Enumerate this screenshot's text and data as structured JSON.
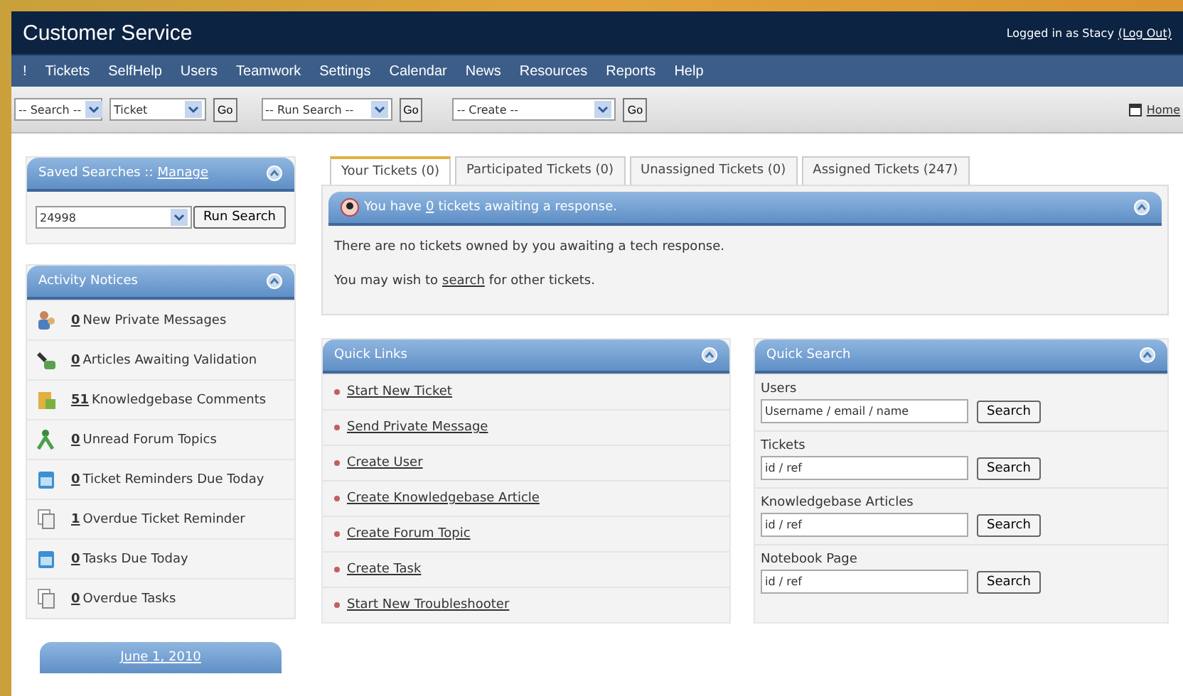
{
  "header": {
    "title": "Customer Service",
    "login_text": "Logged in as Stacy",
    "logout_link": "(Log Out)"
  },
  "nav": [
    "!",
    "Tickets",
    "SelfHelp",
    "Users",
    "Teamwork",
    "Settings",
    "Calendar",
    "News",
    "Resources",
    "Reports",
    "Help"
  ],
  "toolbar": {
    "items": [
      {
        "kind": "dropdown",
        "text": "-- Search --"
      },
      {
        "kind": "dropdown",
        "text": "Ticket"
      },
      {
        "kind": "go",
        "text": "Go"
      },
      {
        "kind": "dropdown",
        "text": "-- Run Search --"
      },
      {
        "kind": "go",
        "text": "Go"
      },
      {
        "kind": "dropdown",
        "text": "-- Create --"
      },
      {
        "kind": "go",
        "text": "Go"
      }
    ],
    "home_link": "Home"
  },
  "saved_searches": {
    "title": "Saved Searches ::",
    "manage_link": "Manage",
    "select_value": "24998",
    "button": "Run Search"
  },
  "activity_notices": {
    "title": "Activity Notices",
    "items": [
      {
        "count": "0",
        "label": "New Private Messages"
      },
      {
        "count": "0",
        "label": "Articles Awaiting Validation"
      },
      {
        "count": "51",
        "label": "Knowledgebase Comments"
      },
      {
        "count": "0",
        "label": "Unread Forum Topics"
      },
      {
        "count": "0",
        "label": "Ticket Reminders Due Today"
      },
      {
        "count": "1",
        "label": "Overdue Ticket Reminder"
      },
      {
        "count": "0",
        "label": "Tasks Due Today"
      },
      {
        "count": "0",
        "label": "Overdue Tasks"
      }
    ]
  },
  "calendar_link": "June 1, 2010",
  "tabs": [
    {
      "label": "Your Tickets (0)",
      "selected": true
    },
    {
      "label": "Participated Tickets (0)",
      "selected": false
    },
    {
      "label": "Unassigned Tickets (0)",
      "selected": false
    },
    {
      "label": "Assigned Tickets (247)",
      "selected": false
    }
  ],
  "tickets_panel": {
    "title_before": "You have",
    "title_count": "0",
    "title_after": "tickets awaiting a response.",
    "message": "There are no tickets owned by you awaiting a tech response.",
    "hint_before": "You may wish to",
    "hint_link": "search",
    "hint_after": "for other tickets."
  },
  "quick_links": {
    "title": "Quick Links",
    "items": [
      "Start New Ticket",
      "Send Private Message",
      "Create User",
      "Create Knowledgebase Article",
      "Create Forum Topic",
      "Create Task",
      "Start New Troubleshooter"
    ]
  },
  "quick_search": {
    "title": "Quick Search",
    "fields": [
      {
        "label": "Users",
        "value": "Username / email / name",
        "button": "Search"
      },
      {
        "label": "Tickets",
        "value": "id / ref",
        "button": "Search"
      },
      {
        "label": "Knowledgebase Articles",
        "value": "id / ref",
        "button": "Search"
      },
      {
        "label": "Notebook Page",
        "value": "id / ref",
        "button": "Search"
      }
    ]
  }
}
